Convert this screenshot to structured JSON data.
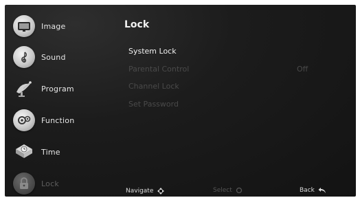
{
  "sidebar": {
    "items": [
      {
        "label": "Image",
        "icon": "image-icon"
      },
      {
        "label": "Sound",
        "icon": "sound-icon"
      },
      {
        "label": "Program",
        "icon": "program-icon"
      },
      {
        "label": "Function",
        "icon": "function-icon"
      },
      {
        "label": "Time",
        "icon": "time-icon"
      },
      {
        "label": "Lock",
        "icon": "lock-icon",
        "selected": true
      }
    ]
  },
  "panel": {
    "title": "Lock",
    "options": [
      {
        "label": "System Lock",
        "enabled": true
      },
      {
        "label": "Parental Control",
        "value": "Off",
        "enabled": false
      },
      {
        "label": "Channel Lock",
        "enabled": false
      },
      {
        "label": "Set Password",
        "enabled": false
      }
    ]
  },
  "footer": {
    "navigate": "Navigate",
    "select": "Select",
    "back": "Back"
  },
  "colors": {
    "background": "#1c1c1c",
    "active_text": "#f0f0f0",
    "disabled_text": "#4a4a4a"
  }
}
